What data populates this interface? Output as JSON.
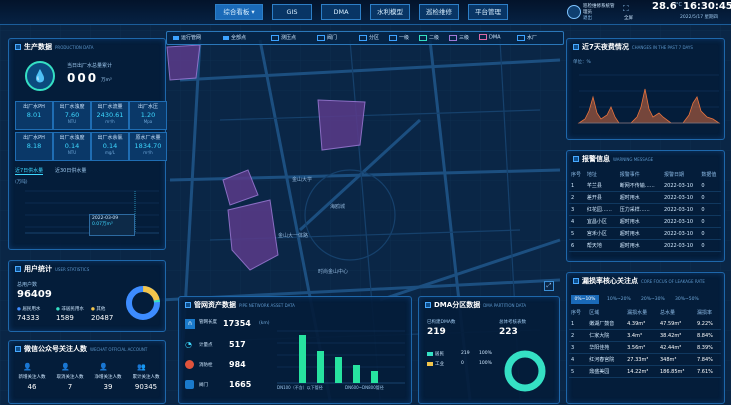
{
  "header": {
    "nav": [
      {
        "label": "综合看板 ▾",
        "active": true
      },
      {
        "label": "GIS",
        "active": false
      },
      {
        "label": "DMA",
        "active": false
      },
      {
        "label": "水利模型",
        "active": false
      },
      {
        "label": "巡检维修",
        "active": false
      },
      {
        "label": "平台管理",
        "active": false
      }
    ],
    "user_line1": "巡检维修系统管",
    "user_line2": "理员",
    "logout": "退出",
    "fullscreen": "全屏",
    "temperature": "28.6",
    "time": "16:30:45",
    "weather_unit": "°C",
    "date": "2022/5/17 星期四"
  },
  "toolbar": {
    "items": [
      "运行管网",
      "全部点",
      "测压点",
      "阀门",
      "分区",
      "一级",
      "二级",
      "三级",
      "DMA",
      "水厂"
    ]
  },
  "production": {
    "title": "生产数据",
    "title_en": "PRODUCTION DATA",
    "daily_label": "当日出厂水总量累计",
    "daily_value": "000",
    "daily_unit": "万m³",
    "metrics": [
      {
        "label": "出厂水PH",
        "value": "8.01",
        "unit": ""
      },
      {
        "label": "出厂水浊度",
        "value": "7.60",
        "unit": "NTU"
      },
      {
        "label": "出厂水流量",
        "value": "2430.61",
        "unit": "m³/h"
      },
      {
        "label": "出厂水压",
        "value": "1.20",
        "unit": "Mpa"
      },
      {
        "label": "出厂水PH",
        "value": "8.18",
        "unit": ""
      },
      {
        "label": "出厂水浊度",
        "value": "0.14",
        "unit": "NTU"
      },
      {
        "label": "出厂水余氯",
        "value": "0.14",
        "unit": "mg/L"
      },
      {
        "label": "原水厂水量",
        "value": "1834.70",
        "unit": "m³/h"
      }
    ],
    "tabs": [
      "近7日供水量",
      "近30日供水量"
    ],
    "chart_unit": "(万吨)",
    "tooltip_date": "2022-03-09",
    "tooltip_value": "0.07万m³"
  },
  "user_stats": {
    "title": "用户统计",
    "title_en": "USER STATISTICS",
    "total_label": "总用户数",
    "total_value": "96409",
    "items": [
      {
        "label": "居民用水",
        "value": "74333",
        "color": "#3d8cff"
      },
      {
        "label": "非居民用水",
        "value": "1589",
        "color": "#35e0c4"
      },
      {
        "label": "其他",
        "value": "20487",
        "color": "#f3c54b"
      }
    ]
  },
  "wechat": {
    "title": "微信公众号关注人数",
    "title_en": "WECHAT OFFICIAL ACCOUNT",
    "items": [
      {
        "label": "新增关注人数",
        "value": "46"
      },
      {
        "label": "取消关注人数",
        "value": "7"
      },
      {
        "label": "净增关注人数",
        "value": "39"
      },
      {
        "label": "累计关注人数",
        "value": "90345"
      }
    ]
  },
  "pipe": {
    "title": "管网资产数据",
    "title_en": "PIPE NETWORK ASSET DATA",
    "items": [
      {
        "label": "管网长度",
        "value": "17354"
      },
      {
        "label": "计量点",
        "value": "517"
      },
      {
        "label": "消防栓",
        "value": "984"
      },
      {
        "label": "阀门",
        "value": "1665"
      }
    ],
    "axis_unit": "(km)",
    "x_labels": [
      "DN100（不含）以下管径",
      "DN600~DN800管径"
    ]
  },
  "dma": {
    "title": "DMA分区数据",
    "title_en": "DMA PARTITION DATA",
    "built_label": "已构建DMA数",
    "built_value": "219",
    "total_label": "总体考核表数",
    "total_value": "223",
    "legend": [
      {
        "label": "居民",
        "count": "219",
        "pct": "100%",
        "color": "#35e0c4"
      },
      {
        "label": "工业",
        "count": "0",
        "pct": "100%",
        "color": "#f3c54b"
      }
    ]
  },
  "changes": {
    "title": "近7天夜费情况",
    "title_en": "CHANGES IN THE PAST 7 DAYS",
    "y_unit": "单位：%",
    "chart_data": {
      "type": "area",
      "x": [
        "1",
        "2",
        "3",
        "4",
        "5",
        "6",
        "7"
      ]
    }
  },
  "alarm": {
    "title": "报警信息",
    "title_en": "WARNING MESSAGE",
    "columns": [
      "序号",
      "地址",
      "报警事件",
      "报警日期",
      "数据值"
    ],
    "rows": [
      [
        "1",
        "芊兰县",
        "断网不传输……",
        "2022-03-10",
        "0"
      ],
      [
        "2",
        "差开县",
        "超时用水",
        "2022-03-10",
        "0"
      ],
      [
        "3",
        "红花园……",
        "压力采样……",
        "2022-03-10",
        "0"
      ],
      [
        "4",
        "宜昌小区",
        "超时用水",
        "2022-03-10",
        "0"
      ],
      [
        "5",
        "宫禾小区",
        "超时用水",
        "2022-03-10",
        "0"
      ],
      [
        "6",
        "帮天地",
        "超时用水",
        "2022-03-10",
        "0"
      ]
    ]
  },
  "leakage": {
    "title": "漏损率核心关注点",
    "title_en": "CORE FOCUS OF LEAKAGE RATE",
    "tabs": [
      "0%~10%",
      "10%~20%",
      "20%~30%",
      "30%~50%"
    ],
    "columns": [
      "序号",
      "区域",
      "漏损水量",
      "总水量",
      "漏损率"
    ],
    "rows": [
      [
        "1",
        "嫩湖厂鼓音",
        "4.39m³",
        "47.59m³",
        "9.22%"
      ],
      [
        "2",
        "仁家大院",
        "3.4m³",
        "38.42m³",
        "8.84%"
      ],
      [
        "3",
        "华阳佳苑",
        "3.56m³",
        "42.44m³",
        "8.39%"
      ],
      [
        "4",
        "红河春宫院",
        "27.33m³",
        "348m³",
        "7.84%"
      ],
      [
        "5",
        "鼎盛美园",
        "14.22m³",
        "186.85m³",
        "7.61%"
      ]
    ]
  },
  "map": {
    "labels": [
      "金山大学",
      "海鸥城",
      "金山大一体路",
      "时尚金山中心"
    ]
  }
}
